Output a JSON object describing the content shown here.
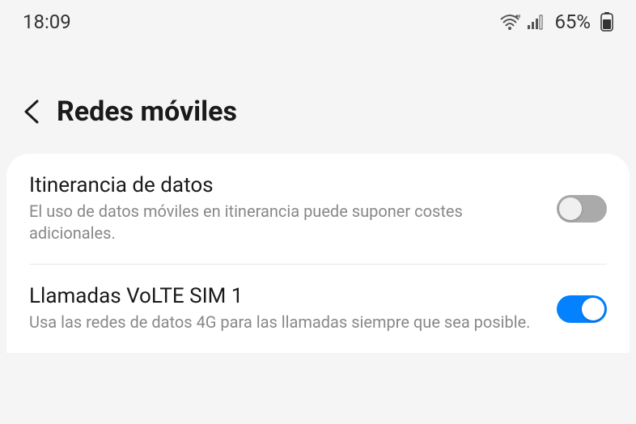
{
  "statusBar": {
    "time": "18:09",
    "battery": "65%"
  },
  "header": {
    "title": "Redes móviles"
  },
  "settings": [
    {
      "title": "Itinerancia de datos",
      "description": "El uso de datos móviles en itinerancia puede suponer costes adicionales.",
      "enabled": false
    },
    {
      "title": "Llamadas VoLTE SIM 1",
      "description": "Usa las redes de datos 4G para las llamadas siempre que sea posible.",
      "enabled": true
    }
  ]
}
